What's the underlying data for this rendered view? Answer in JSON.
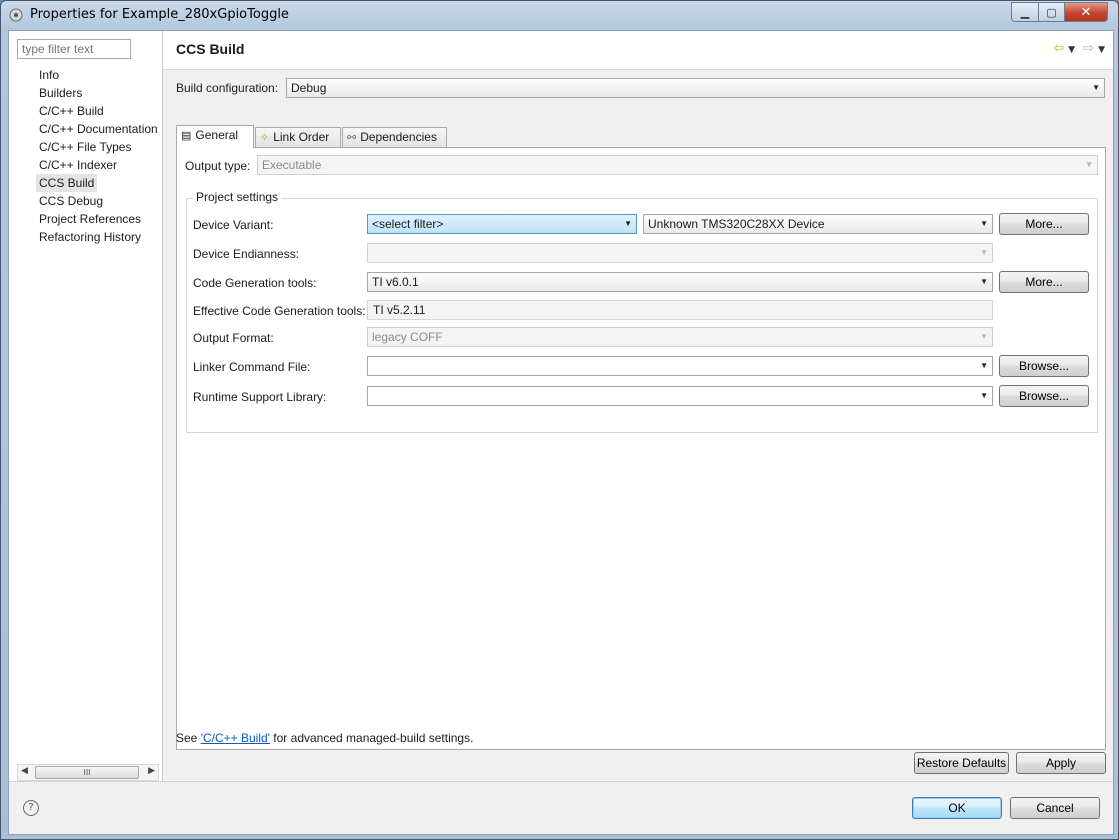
{
  "window": {
    "title": "Properties for Example_280xGpioToggle",
    "minimize": "▁",
    "maximize": "▢",
    "close": "✕"
  },
  "sidebar": {
    "filter_placeholder": "type filter text",
    "items": [
      {
        "label": "Info"
      },
      {
        "label": "Builders"
      },
      {
        "label": "C/C++ Build"
      },
      {
        "label": "C/C++ Documentation"
      },
      {
        "label": "C/C++ File Types"
      },
      {
        "label": "C/C++ Indexer"
      },
      {
        "label": "CCS Build"
      },
      {
        "label": "CCS Debug"
      },
      {
        "label": "Project References"
      },
      {
        "label": "Refactoring History"
      }
    ],
    "selected": "CCS Build",
    "scroll_thumb": "III"
  },
  "page": {
    "title": "CCS Build",
    "build_config_label": "Build configuration:",
    "build_config_value": "Debug"
  },
  "tabs": [
    {
      "label": "General",
      "icon": "table-icon"
    },
    {
      "label": "Link Order",
      "icon": "link-order-icon"
    },
    {
      "label": "Dependencies",
      "icon": "dependencies-icon"
    }
  ],
  "general": {
    "output_type_label": "Output type:",
    "output_type_value": "Executable",
    "group_title": "Project settings",
    "device_variant_label": "Device Variant:",
    "device_variant_filter": "<select filter>",
    "device_variant_value": "Unknown TMS320C28XX Device",
    "device_endianness_label": "Device Endianness:",
    "device_endianness_value": "",
    "cgt_label": "Code Generation tools:",
    "cgt_value": "TI v6.0.1",
    "effective_cgt_label": "Effective Code Generation tools:",
    "effective_cgt_value": "TI v5.2.11",
    "output_format_label": "Output Format:",
    "output_format_value": "legacy COFF",
    "linker_cmd_label": "Linker Command File:",
    "linker_cmd_value": "",
    "runtime_lib_label": "Runtime Support Library:",
    "runtime_lib_value": "",
    "more_label": "More...",
    "browse_label": "Browse..."
  },
  "footer": {
    "note_prefix": "See ",
    "note_link": "'C/C++ Build'",
    "note_suffix": " for advanced managed-build settings.",
    "restore_defaults": "Restore Defaults",
    "apply": "Apply",
    "ok": "OK",
    "cancel": "Cancel",
    "help": "?"
  }
}
